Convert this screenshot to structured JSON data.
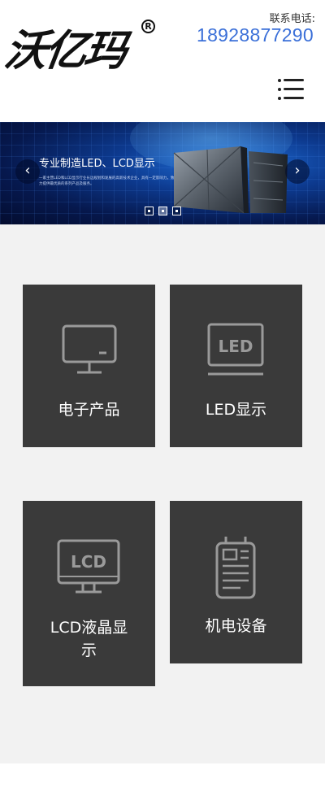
{
  "header": {
    "logo_text": "沃亿玛",
    "registered_mark": "R",
    "phone_label": "联系电话:",
    "phone_number": "18928877290"
  },
  "menu": {
    "icon": "hamburger-menu-icon"
  },
  "banner": {
    "title": "专业制造LED、LCD显示",
    "subtitle": "一家主营LED和LCD显示行业长远规划和发展的高新技术企业，具有一定影响力，致力提供最优质的系列产品及服务。",
    "prev_icon": "chevron-left-icon",
    "next_icon": "chevron-right-icon",
    "slides_total": 3,
    "active_slide": 2
  },
  "categories": [
    {
      "label": "电子产品",
      "icon": "monitor-icon"
    },
    {
      "label": "LED显示",
      "icon": "led-display-icon",
      "icon_text": "LED"
    },
    {
      "label": "LCD液晶显示",
      "label_line1": "LCD液晶显",
      "label_line2": "示",
      "icon": "lcd-monitor-icon",
      "icon_text": "LCD"
    },
    {
      "label": "机电设备",
      "icon": "meter-device-icon"
    }
  ],
  "colors": {
    "phone": "#3a6fd8",
    "card_bg": "#3a3a3a",
    "content_bg": "#f2f2f2",
    "icon_stroke": "#9a9a9a"
  }
}
